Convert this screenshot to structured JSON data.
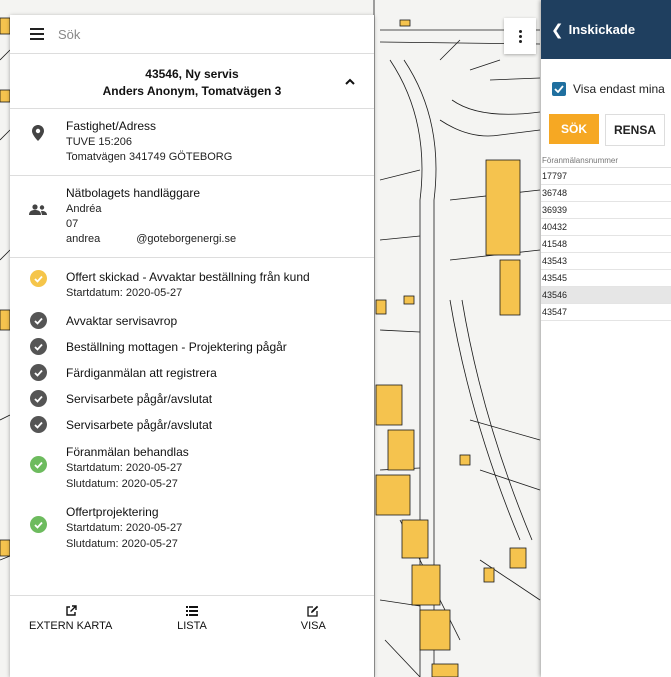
{
  "search": {
    "placeholder": "Sök"
  },
  "header": {
    "title_line1": "43546, Ny servis",
    "title_line2": "Anders Anonym, Tomatvägen 3"
  },
  "property": {
    "label": "Fastighet/Adress",
    "line1": "TUVE 15:206",
    "line2": "Tomatvägen 341749 GÖTEBORG"
  },
  "handler": {
    "label": "Nätbolagets handläggare",
    "name": "Andréa",
    "phone": "07",
    "email_user": "andrea",
    "email_domain": "@goteborgenergi.se"
  },
  "steps": [
    {
      "label": "Offert skickad - Avvaktar beställning från kund",
      "sub1": "Startdatum: 2020-05-27",
      "sub2": "",
      "status": "active"
    },
    {
      "label": "Avvaktar servisavrop",
      "sub1": "",
      "sub2": "",
      "status": "pending"
    },
    {
      "label": "Beställning mottagen - Projektering pågår",
      "sub1": "",
      "sub2": "",
      "status": "pending"
    },
    {
      "label": "Färdiganmälan att registrera",
      "sub1": "",
      "sub2": "",
      "status": "pending"
    },
    {
      "label": "Servisarbete pågår/avslutat",
      "sub1": "",
      "sub2": "",
      "status": "pending"
    },
    {
      "label": "Servisarbete pågår/avslutat",
      "sub1": "",
      "sub2": "",
      "status": "pending"
    },
    {
      "label": "Föranmälan behandlas",
      "sub1": "Startdatum: 2020-05-27",
      "sub2": "Slutdatum: 2020-05-27",
      "status": "done"
    },
    {
      "label": "Offertprojektering",
      "sub1": "Startdatum: 2020-05-27",
      "sub2": "Slutdatum: 2020-05-27",
      "status": "done"
    }
  ],
  "footer": {
    "extern_karta": "EXTERN KARTA",
    "lista": "LISTA",
    "visa": "VISA"
  },
  "right": {
    "title": "Inskickade",
    "checkbox_label": "Visa endast mina",
    "sok": "SÖK",
    "rensa": "RENSA",
    "column_header": "Föranmälansnummer",
    "rows": [
      "17797",
      "36748",
      "36939",
      "40432",
      "41548",
      "43543",
      "43545",
      "43546",
      "43547"
    ],
    "selected": "43546"
  },
  "colors": {
    "accent": "#f6a823",
    "header_blue": "#1f3f5f",
    "active": "#f5c54a",
    "pending": "#555555",
    "done": "#6dbb5e",
    "building": "#f5c34e"
  },
  "icons": [
    "menu-icon",
    "chevron-up-icon",
    "map-pin-icon",
    "people-icon",
    "check-icon",
    "external-link-icon",
    "list-icon",
    "edit-icon",
    "kebab-icon",
    "chevron-left-icon"
  ]
}
